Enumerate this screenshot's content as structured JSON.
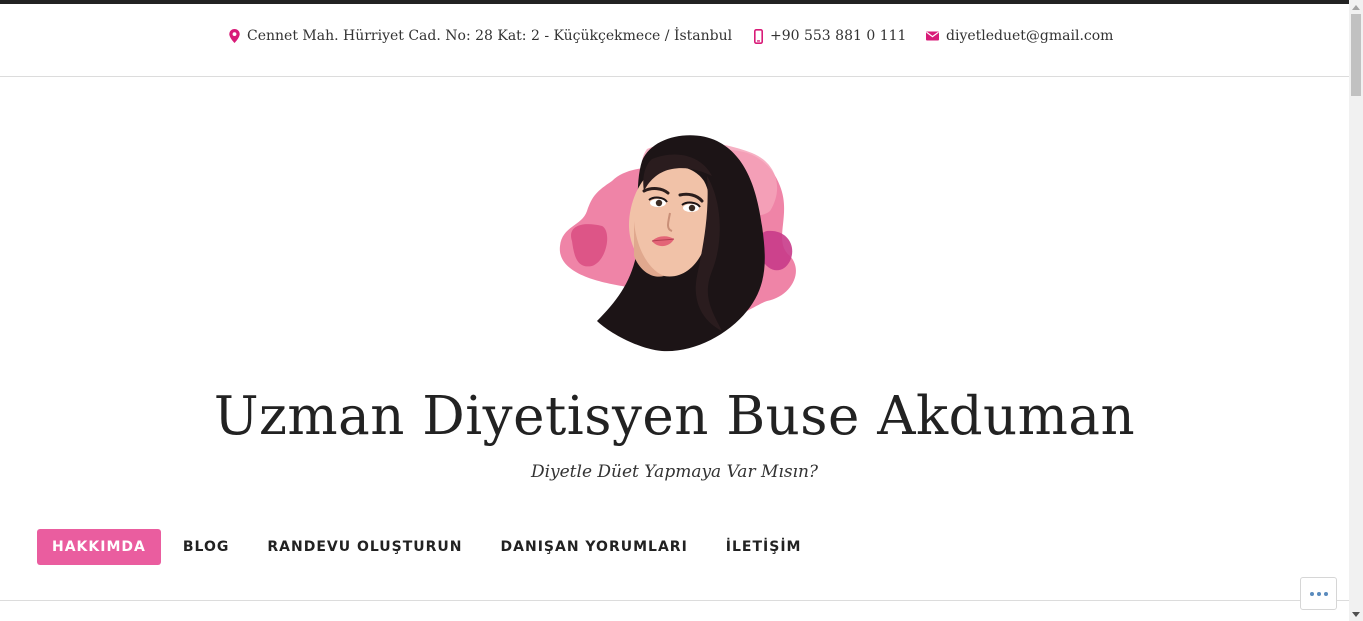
{
  "topbar": {
    "address": "Cennet Mah. Hürriyet Cad. No: 28 Kat: 2 - Küçükçekmece / İstanbul",
    "phone": "+90 553 881 0 111",
    "email": "diyetleduet@gmail.com",
    "icons": [
      "map-pin-icon",
      "mobile-phone-icon",
      "envelope-icon"
    ],
    "icon_color": "#d81b78"
  },
  "header": {
    "title": "Uzman Diyetisyen Buse Akduman",
    "tagline": "Diyetle Düet Yapmaya Var Mısın?"
  },
  "nav": {
    "items": [
      "HAKKIMDA",
      "BLOG",
      "RANDEVU OLUŞTURUN",
      "DANIŞAN YORUMLARI",
      "İLETİŞİM"
    ],
    "active_index": 0,
    "active_color": "#ea5d9f"
  },
  "more_button": {
    "icon": "ellipsis-icon"
  }
}
